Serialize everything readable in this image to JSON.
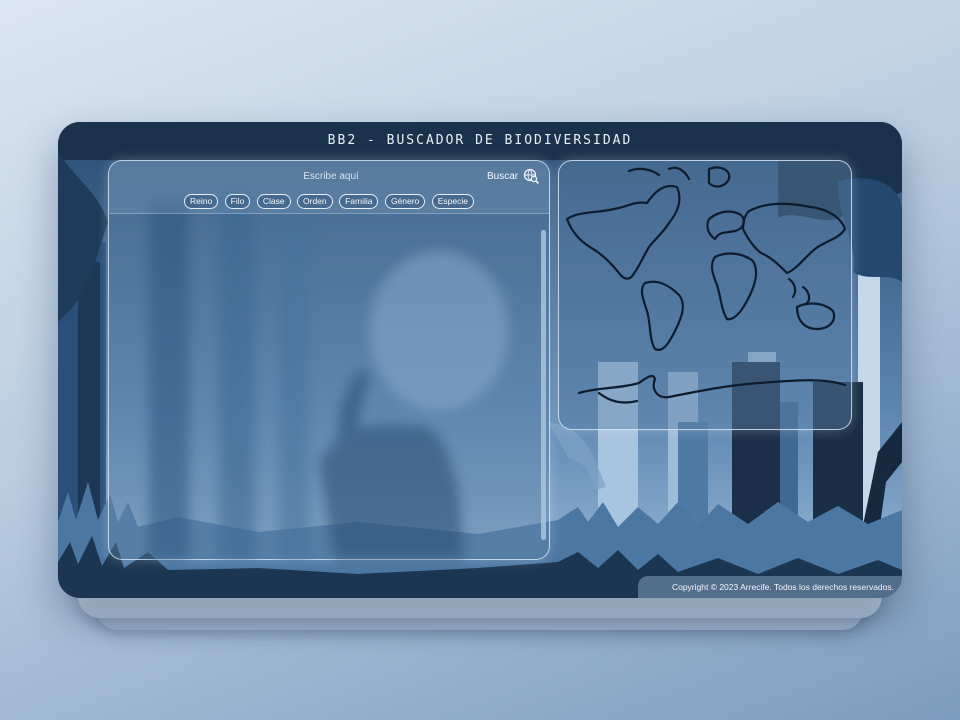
{
  "app": {
    "title": "BB2 - BUSCADOR DE BIODIVERSIDAD"
  },
  "search": {
    "placeholder": "Escribe aquí",
    "button_label": "Buscar",
    "button_icon": "search-globe-icon"
  },
  "filters": [
    {
      "label": "Reino"
    },
    {
      "label": "Filo"
    },
    {
      "label": "Clase"
    },
    {
      "label": "Orden"
    },
    {
      "label": "Familia"
    },
    {
      "label": "Género"
    },
    {
      "label": "Especie"
    }
  ],
  "map": {
    "icon": "world-map"
  },
  "footer": {
    "copyright": "Copyright © 2023 Arrecife. Todos los derechos reservados."
  },
  "colors": {
    "window_bg": "#22405f",
    "forest_dark": "#16283c",
    "forest_mid": "#2f5a86",
    "forest_light": "#7ea3c9",
    "sky": "#b7cfe6",
    "text": "#f0f5fa"
  }
}
